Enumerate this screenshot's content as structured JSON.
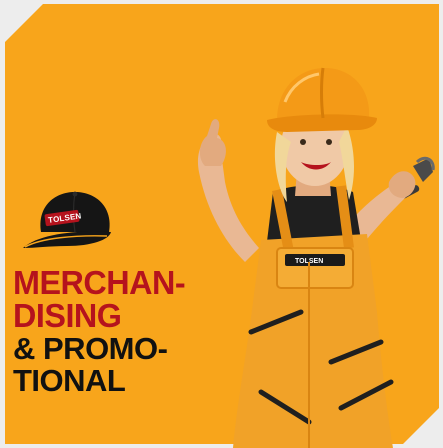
{
  "promo": {
    "headline_line1": "MERCHAN-",
    "headline_line2": "DISING",
    "headline_line3": "& PROMO-",
    "headline_line4": "TIONAL",
    "cap_logo": "TOLSEN",
    "overall_logo": "TOLSEN"
  },
  "colors": {
    "background": "#f8a51b",
    "accent_red": "#b5131d",
    "text_dark": "#111111",
    "page_bg": "#ededed"
  },
  "icons": [
    "cap-icon",
    "worker-illustration",
    "hammer-icon",
    "hard-hat-icon"
  ]
}
